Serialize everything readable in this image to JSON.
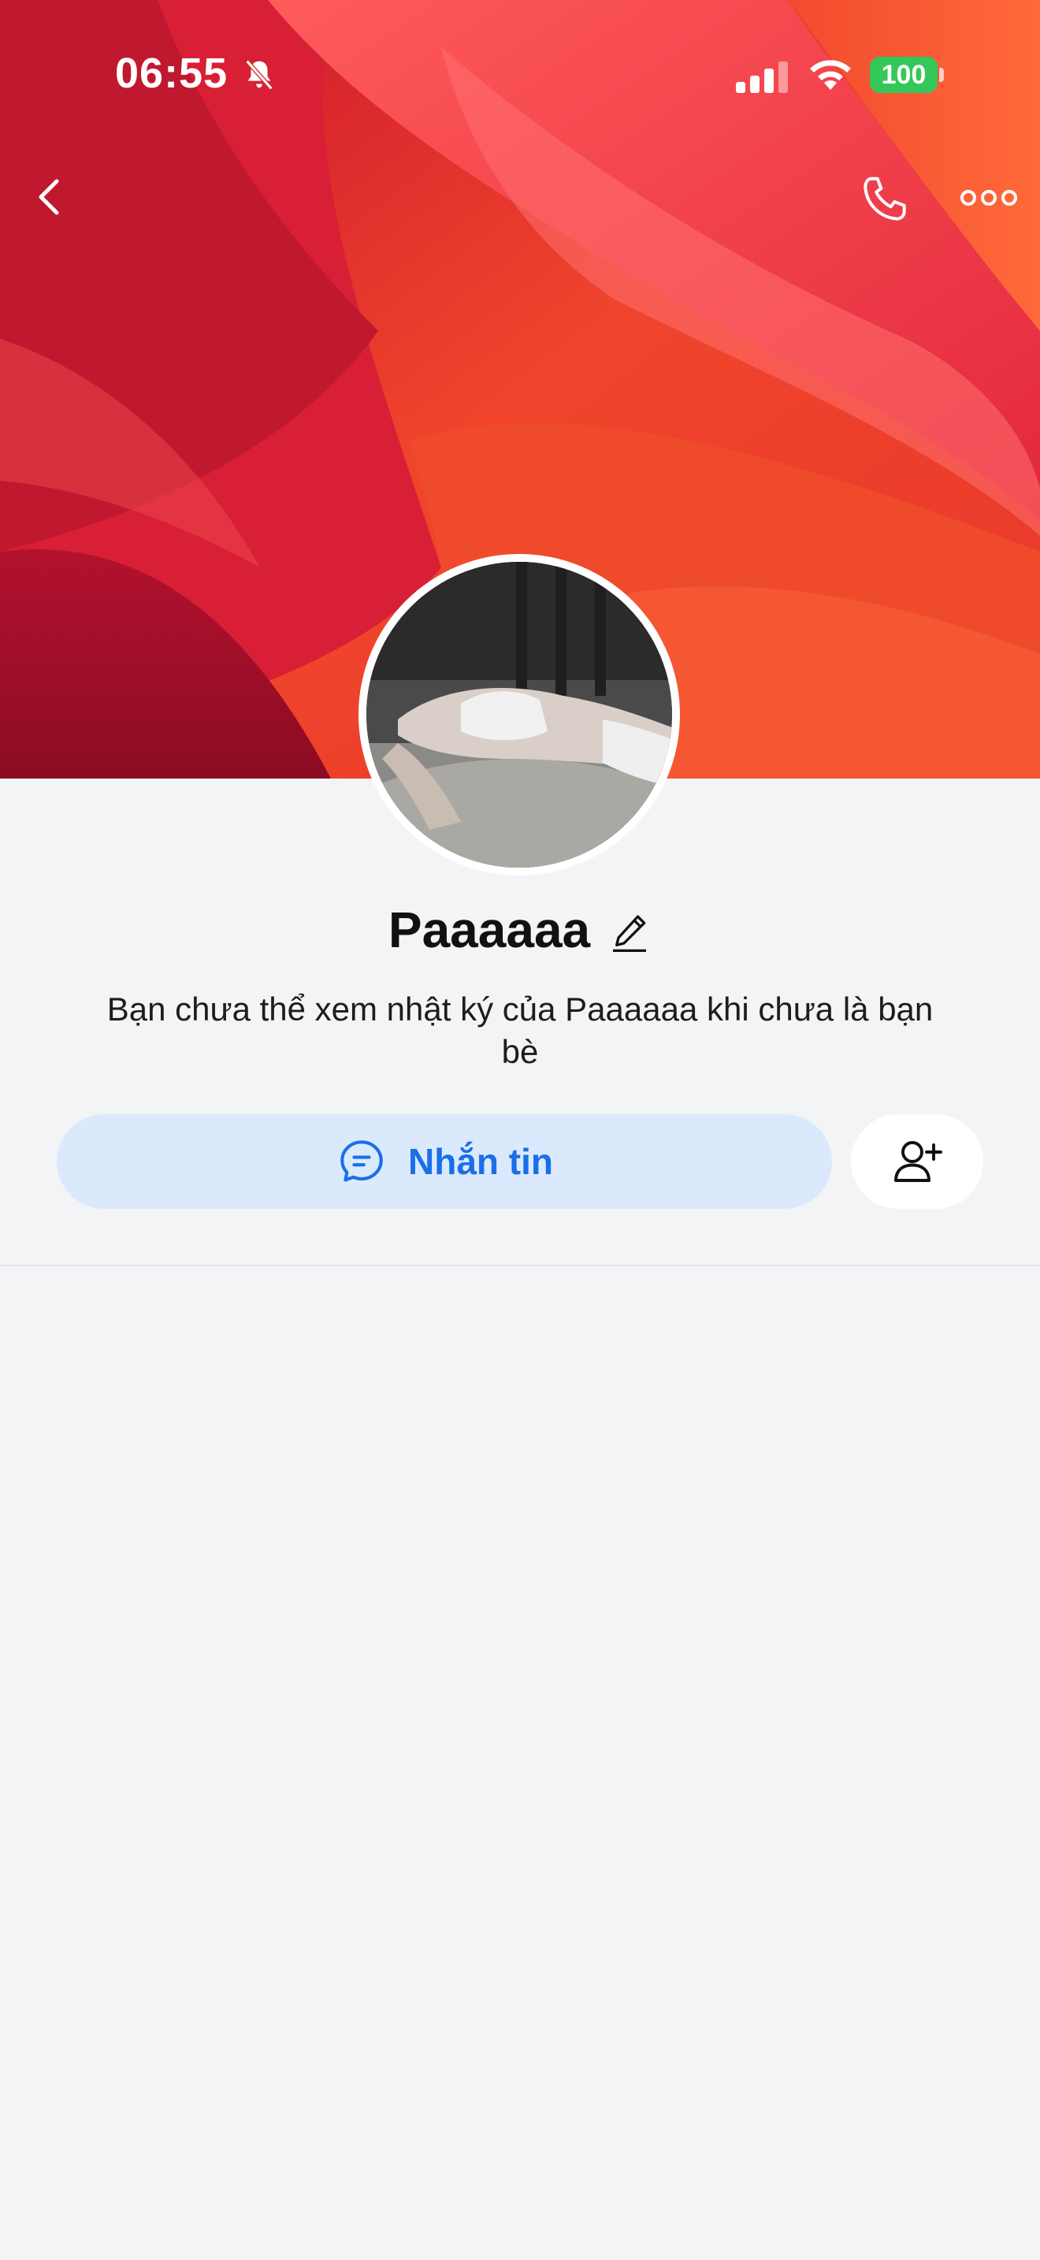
{
  "status_bar": {
    "time": "06:55",
    "battery": "100"
  },
  "nav": {
    "back_icon": "chevron-left-icon",
    "call_icon": "phone-icon",
    "more_icon": "more-horizontal-icon"
  },
  "profile": {
    "name": "Paaaaaa",
    "notice": "Bạn chưa thể xem nhật ký của Paaaaaa khi chưa là bạn bè"
  },
  "actions": {
    "message_label": "Nhắn tin",
    "add_friend_icon": "user-plus-icon"
  },
  "colors": {
    "accent": "#1a6fe6",
    "message_button_bg": "#dbe9fd",
    "battery": "#34c759",
    "background": "#f3f4f6"
  }
}
